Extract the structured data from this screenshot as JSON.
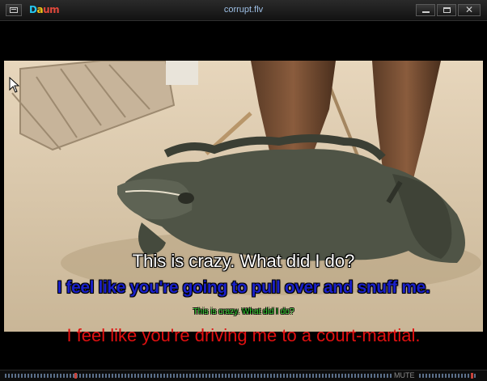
{
  "window": {
    "title": "corrupt.flv",
    "logo": {
      "part1": "D",
      "part2": "a",
      "part3": "um"
    },
    "buttons": {
      "minimize": "minimize-icon",
      "maximize": "maximize-icon",
      "close_glyph": "✕"
    }
  },
  "subtitles": {
    "line1": "This is crazy. What did I do?",
    "line2": "I feel like you're going to pull over and snuff me.",
    "line3": "This is crazy. What did I do?",
    "line4": "I feel like you're driving me to a court-martial."
  },
  "subtitle_colors": {
    "line1": "#ffffff",
    "line2": "#1a20c8",
    "line3": "#2fd02f",
    "line4": "#e01010"
  },
  "statusbar": {
    "mute_label": "MUTE",
    "seek_progress": 0.18,
    "volume_level": 0.95
  },
  "colors": {
    "title_text": "#9ec0e6",
    "background": "#000000"
  }
}
